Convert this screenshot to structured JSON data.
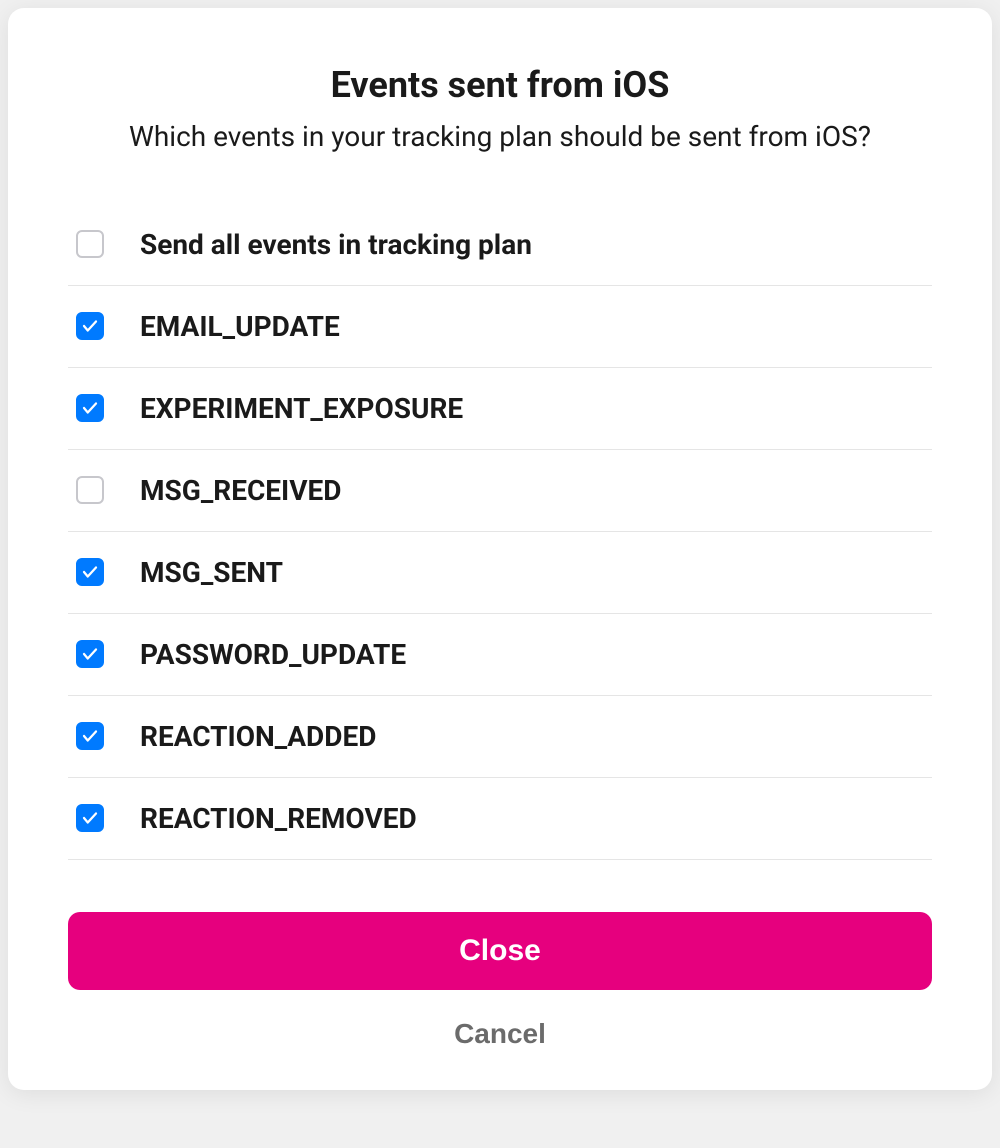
{
  "modal": {
    "title": "Events sent from iOS",
    "subtitle": "Which events in your tracking plan should be sent from iOS?"
  },
  "select_all": {
    "label": "Send all events in tracking plan",
    "checked": false
  },
  "events": [
    {
      "name": "EMAIL_UPDATE",
      "checked": true
    },
    {
      "name": "EXPERIMENT_EXPOSURE",
      "checked": true
    },
    {
      "name": "MSG_RECEIVED",
      "checked": false
    },
    {
      "name": "MSG_SENT",
      "checked": true
    },
    {
      "name": "PASSWORD_UPDATE",
      "checked": true
    },
    {
      "name": "REACTION_ADDED",
      "checked": true
    },
    {
      "name": "REACTION_REMOVED",
      "checked": true
    }
  ],
  "actions": {
    "close_label": "Close",
    "cancel_label": "Cancel"
  },
  "colors": {
    "accent": "#e6007e",
    "checkbox_checked": "#007aff"
  }
}
